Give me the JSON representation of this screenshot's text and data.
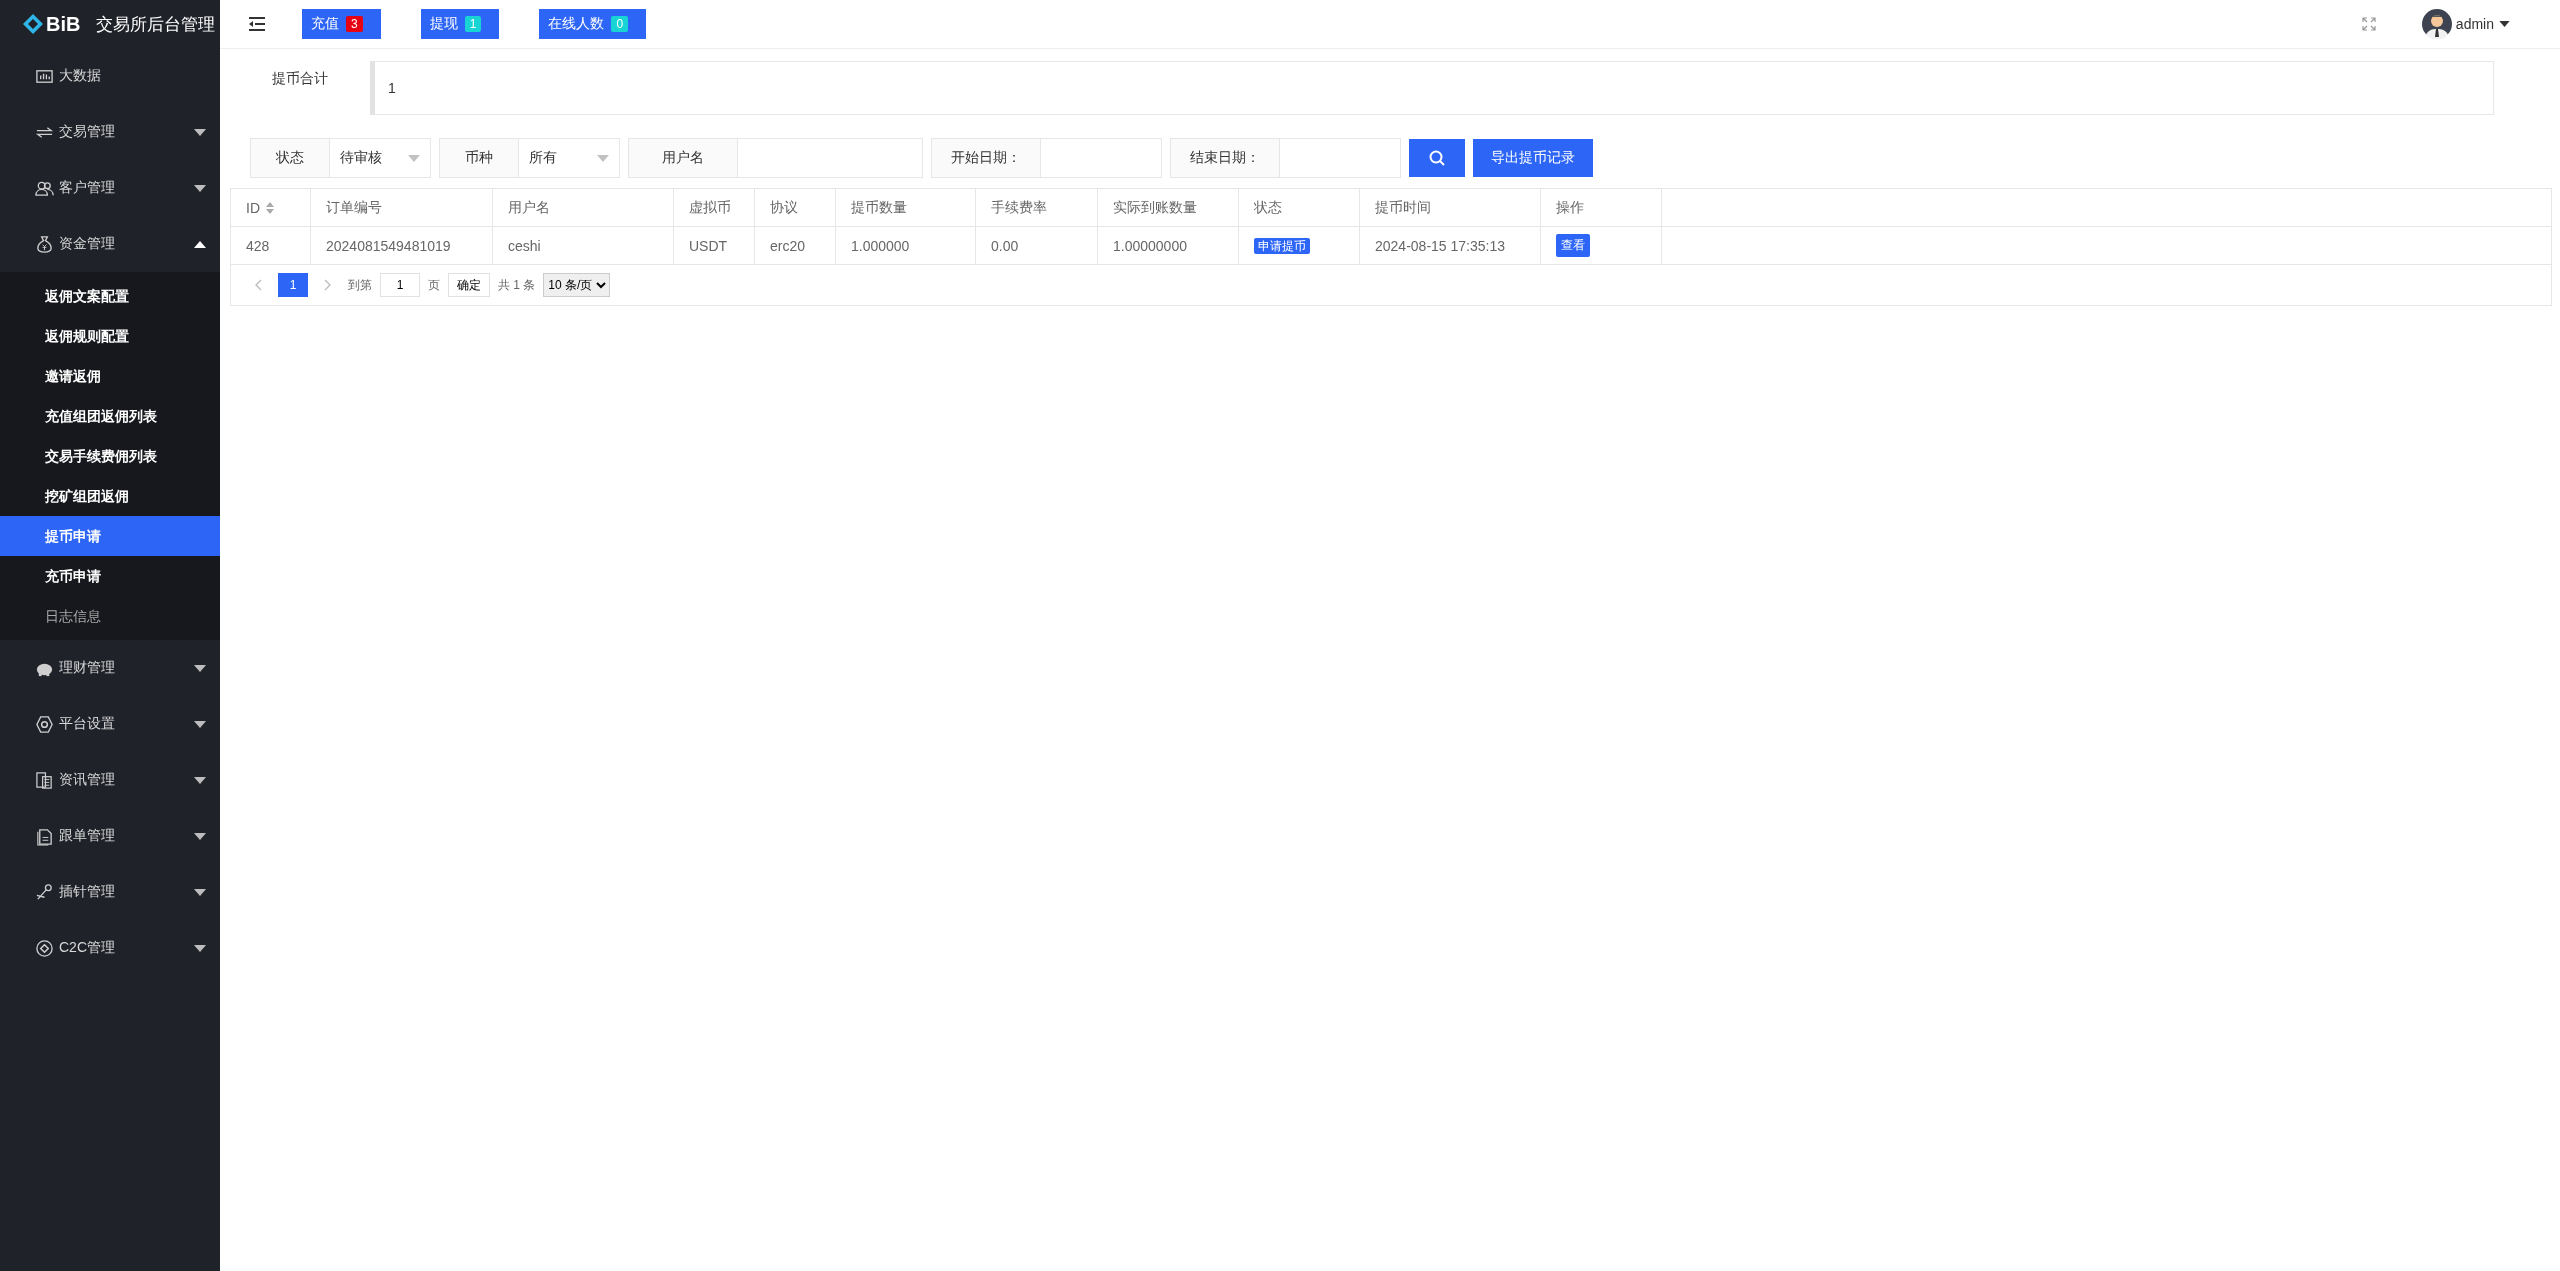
{
  "sidebar": {
    "logo": "BiB",
    "title": "交易所后台管理",
    "items": [
      {
        "label": "大数据"
      },
      {
        "label": "交易管理",
        "expanded": false
      },
      {
        "label": "客户管理",
        "expanded": false
      },
      {
        "label": "资金管理",
        "expanded": true,
        "children": [
          {
            "label": "返佣文案配置",
            "selected": false,
            "disabled": false
          },
          {
            "label": "返佣规则配置",
            "selected": false,
            "disabled": false
          },
          {
            "label": "邀请返佣",
            "selected": false,
            "disabled": false
          },
          {
            "label": "充值组团返佣列表",
            "selected": false,
            "disabled": false
          },
          {
            "label": "交易手续费佣列表",
            "selected": false,
            "disabled": false
          },
          {
            "label": "挖矿组团返佣",
            "selected": false,
            "disabled": false
          },
          {
            "label": "提币申请",
            "selected": true,
            "disabled": false
          },
          {
            "label": "充币申请",
            "selected": false,
            "disabled": false
          },
          {
            "label": "日志信息",
            "selected": false,
            "disabled": true
          }
        ]
      },
      {
        "label": "理财管理",
        "expanded": false
      },
      {
        "label": "平台设置",
        "expanded": false
      },
      {
        "label": "资讯管理",
        "expanded": false
      },
      {
        "label": "跟单管理",
        "expanded": false
      },
      {
        "label": "插针管理",
        "expanded": false
      },
      {
        "label": "C2C管理",
        "expanded": false
      }
    ]
  },
  "topbar": {
    "badges": [
      {
        "label": "充值",
        "count": "3",
        "color": "#e60012"
      },
      {
        "label": "提现",
        "count": "1",
        "color": "#19d4d4"
      },
      {
        "label": "在线人数",
        "count": "0",
        "color": "#19d4d4"
      }
    ],
    "user": "admin"
  },
  "summary": {
    "label": "提币合计",
    "value": "1"
  },
  "filters": [
    {
      "kind": "select",
      "label": "状态",
      "value": "待审核"
    },
    {
      "kind": "select",
      "label": "币种",
      "value": "所有"
    },
    {
      "kind": "text",
      "label": "用户名"
    },
    {
      "kind": "text",
      "label": "开始日期："
    },
    {
      "kind": "text",
      "label": "结束日期："
    }
  ],
  "export_button": "导出提币记录",
  "table": {
    "columns": [
      "ID",
      "订单编号",
      "用户名",
      "虚拟币",
      "协议",
      "提币数量",
      "手续费率",
      "实际到账数量",
      "状态",
      "提币时间",
      "操作"
    ],
    "rows": [
      {
        "cells": [
          "428",
          "2024081549481019",
          "ceshi",
          "USDT",
          "erc20",
          "1.000000",
          "0.00",
          "1.00000000"
        ],
        "status": "申请提币",
        "time": "2024-08-15 17:35:13",
        "action": "查看"
      }
    ]
  },
  "pager": {
    "pages": [
      {
        "label": "1",
        "selected": true
      }
    ],
    "goto_label": "到第",
    "goto_value": "1",
    "page_unit": "页",
    "confirm": "确定",
    "total": "共 1 条",
    "page_size": "10 条/页"
  }
}
